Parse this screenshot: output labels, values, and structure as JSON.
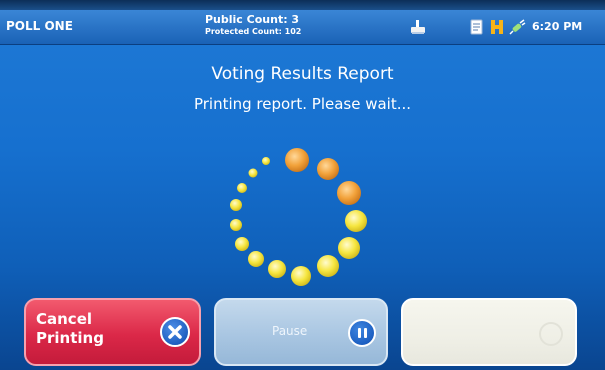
{
  "status_bar": {
    "poll_name": "POLL ONE",
    "public_count": "Public Count: 3",
    "protected_count": "Protected Count: 102",
    "time": "6:20 PM",
    "icons": [
      "printer-icon",
      "document-icon",
      "h-icon",
      "plug-icon"
    ]
  },
  "main": {
    "title": "Voting Results Report",
    "status": "Printing report. Please wait..."
  },
  "buttons": {
    "cancel_label_line1": "Cancel",
    "cancel_label_line2": "Printing",
    "pause_label": "Pause"
  },
  "colors": {
    "cancel": "#db2848",
    "pause": "#a9c6e2",
    "spinner_orange": "#f0a030",
    "spinner_yellow": "#f5e33a"
  }
}
